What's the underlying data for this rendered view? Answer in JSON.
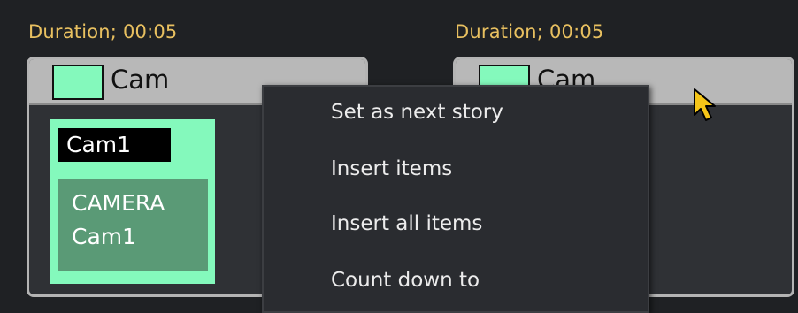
{
  "stories": [
    {
      "duration": "Duration; 00:05",
      "title": "Cam",
      "item": {
        "label": "Cam1",
        "type": "CAMERA",
        "source": "Cam1"
      }
    },
    {
      "duration": "Duration; 00:05",
      "title": "Cam"
    }
  ],
  "context_menu": {
    "items": [
      "Set as next story",
      "Insert items",
      "Insert all items",
      "Count down to"
    ]
  },
  "colors": {
    "background": "#1f2124",
    "duration_text": "#e8c060",
    "cam_swatch": "#84f9bc",
    "item_inner": "#5a9a76",
    "menu_bg": "#2a2c30",
    "cursor": "#f5c518"
  },
  "icons": {
    "cursor": "mouse-pointer-icon"
  }
}
